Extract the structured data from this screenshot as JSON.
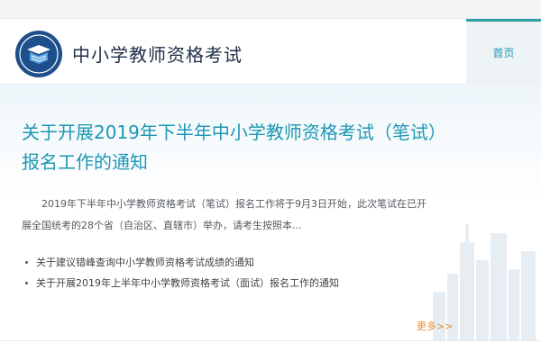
{
  "header": {
    "site_title": "中小学教师资格考试",
    "logo_icon": "book-emblem-icon",
    "nav_home_label": "首页"
  },
  "article": {
    "headline": "关于开展2019年下半年中小学教师资格考试（笔试）报名工作的通知",
    "summary": "2019年下半年中小学教师资格考试（笔试）报名工作将于9月3日开始，此次笔试在已开展全国统考的28个省（自治区、直辖市）举办，请考生按照本..."
  },
  "related_links": [
    "关于建议错峰查询中小学教师资格考试成绩的通知",
    "关于开展2019年上半年中小学教师资格考试（面试）报名工作的通知"
  ],
  "more_label": "更多>>",
  "colors": {
    "accent": "#1e97b3",
    "title": "#1f2f48",
    "more": "#e88a2e",
    "nav_active_border": "#2f9fa2"
  }
}
